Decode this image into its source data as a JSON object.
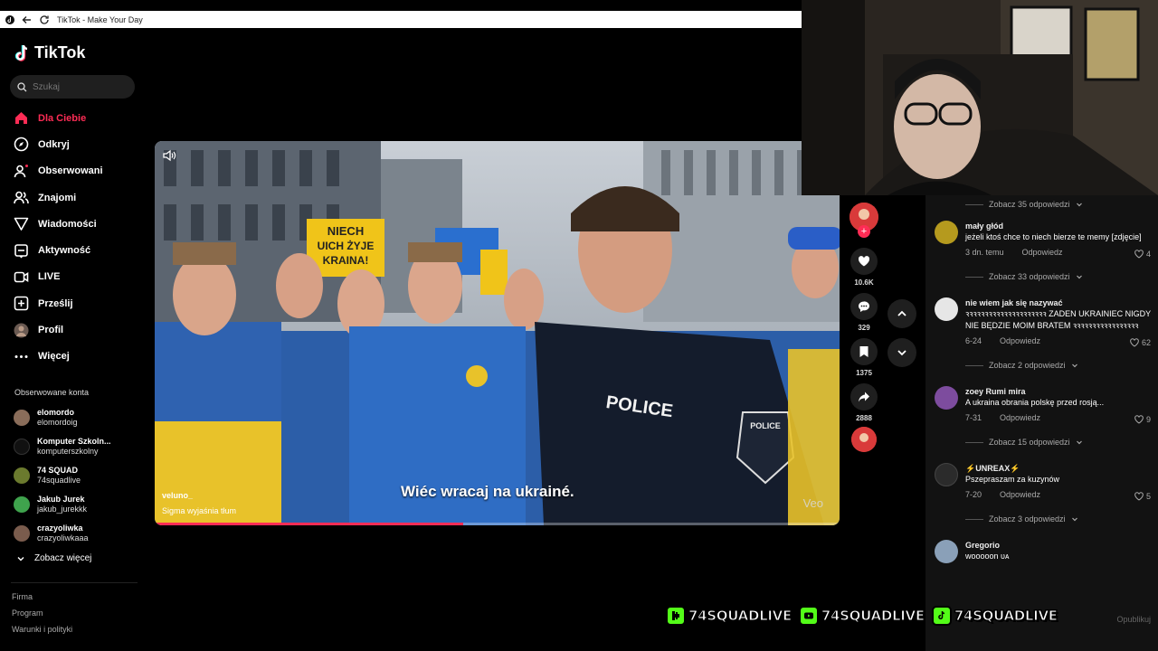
{
  "browser": {
    "title": "TikTok - Make Your Day"
  },
  "sidebar": {
    "logo": "TikTok",
    "search_placeholder": "Szukaj",
    "nav": [
      {
        "label": "Dla Ciebie",
        "icon": "home-icon",
        "active": true
      },
      {
        "label": "Odkryj",
        "icon": "compass-icon"
      },
      {
        "label": "Obserwowani",
        "icon": "following-icon"
      },
      {
        "label": "Znajomi",
        "icon": "friends-icon"
      },
      {
        "label": "Wiadomości",
        "icon": "messages-icon"
      },
      {
        "label": "Aktywność",
        "icon": "activity-icon"
      },
      {
        "label": "LIVE",
        "icon": "live-icon"
      },
      {
        "label": "Prześlij",
        "icon": "upload-icon"
      },
      {
        "label": "Profil",
        "icon": "profile-avatar"
      },
      {
        "label": "Więcej",
        "icon": "more-icon"
      }
    ],
    "followed_title": "Obserwowane konta",
    "accounts": [
      {
        "name": "elomordo",
        "handle": "elomordoig",
        "color": "#8a6d5a"
      },
      {
        "name": "Komputer Szkoln...",
        "handle": "komputerszkolny",
        "color": "#111111"
      },
      {
        "name": "74 SQUAD",
        "handle": "74squadlive",
        "color": "#6b7a2e"
      },
      {
        "name": "Jakub Jurek",
        "handle": "jakub_jurekkk",
        "color": "#3fa34d"
      },
      {
        "name": "crazyoliwka",
        "handle": "crazyoliwkaaa",
        "color": "#7a5c4d"
      }
    ],
    "see_more": "Zobacz więcej",
    "footer": [
      "Firma",
      "Program",
      "Warunki i polityki"
    ]
  },
  "video": {
    "subtitle": "Wiéc wracaj na ukrainé.",
    "author": "veluno_",
    "description": "Sigma wyjaśnia tłum",
    "watermark": "Veo",
    "sign_text": "NIECH\nUICH ŻYJE\nKRAINA!",
    "police_text": "POLICE",
    "progress": 0.45
  },
  "actions": {
    "likes": "10.6K",
    "comments": "329",
    "saves": "1375",
    "shares": "2888"
  },
  "comments": {
    "top_more": "Zobacz 35 odpowiedzi",
    "items": [
      {
        "name": "mały głód",
        "text": "jeżeli ktoś chce to niech bierze te memy [zdjęcie]",
        "date": "3 dn. temu",
        "reply": "Odpowiedz",
        "likes": "4",
        "more": "Zobacz 33 odpowiedzi",
        "color": "#b59a1e"
      },
      {
        "name": "nie wiem jak się nazywać",
        "text": "ꝛꝛꝛꝛꝛꝛꝛꝛꝛꝛꝛꝛꝛꝛꝛꝛꝛꝛꝛꝛꝛ ZADEN UKRAINIEC NIGDY NIE BĘDZIE MOIM BRATEM ꝛꝛꝛꝛꝛꝛꝛꝛꝛꝛꝛꝛꝛꝛꝛꝛꝛ",
        "date": "6-24",
        "reply": "Odpowiedz",
        "likes": "62",
        "more": "Zobacz 2 odpowiedzi",
        "color": "#dddddd"
      },
      {
        "name": "zoey Rumi mira",
        "text": "A ukraina obrania polskę przed rosją...",
        "date": "7-31",
        "reply": "Odpowiedz",
        "likes": "9",
        "more": "Zobacz 15 odpowiedzi",
        "color": "#7d4c9e"
      },
      {
        "name": "⚡UNREAX⚡",
        "text": "Pszepraszam za kuzynów",
        "date": "7-20",
        "reply": "Odpowiedz",
        "likes": "5",
        "more": "Zobacz 3 odpowiedzi",
        "color": "#2b2b2b"
      },
      {
        "name": "Gregorio",
        "text": "wooooon ᴜᴀ",
        "date": "",
        "reply": "",
        "likes": "",
        "more": "",
        "color": "#8aa0b8"
      }
    ],
    "publish": "Opublikuj"
  },
  "overlay": {
    "badges": [
      {
        "text": "74SQUADLIVE",
        "icon": "kick-icon",
        "color": "#53fc18"
      },
      {
        "text": "74SQUADLIVE",
        "icon": "youtube-icon",
        "color": "#53fc18"
      },
      {
        "text": "74SQUADLIVE",
        "icon": "tiktok-icon",
        "color": "#53fc18"
      }
    ]
  }
}
